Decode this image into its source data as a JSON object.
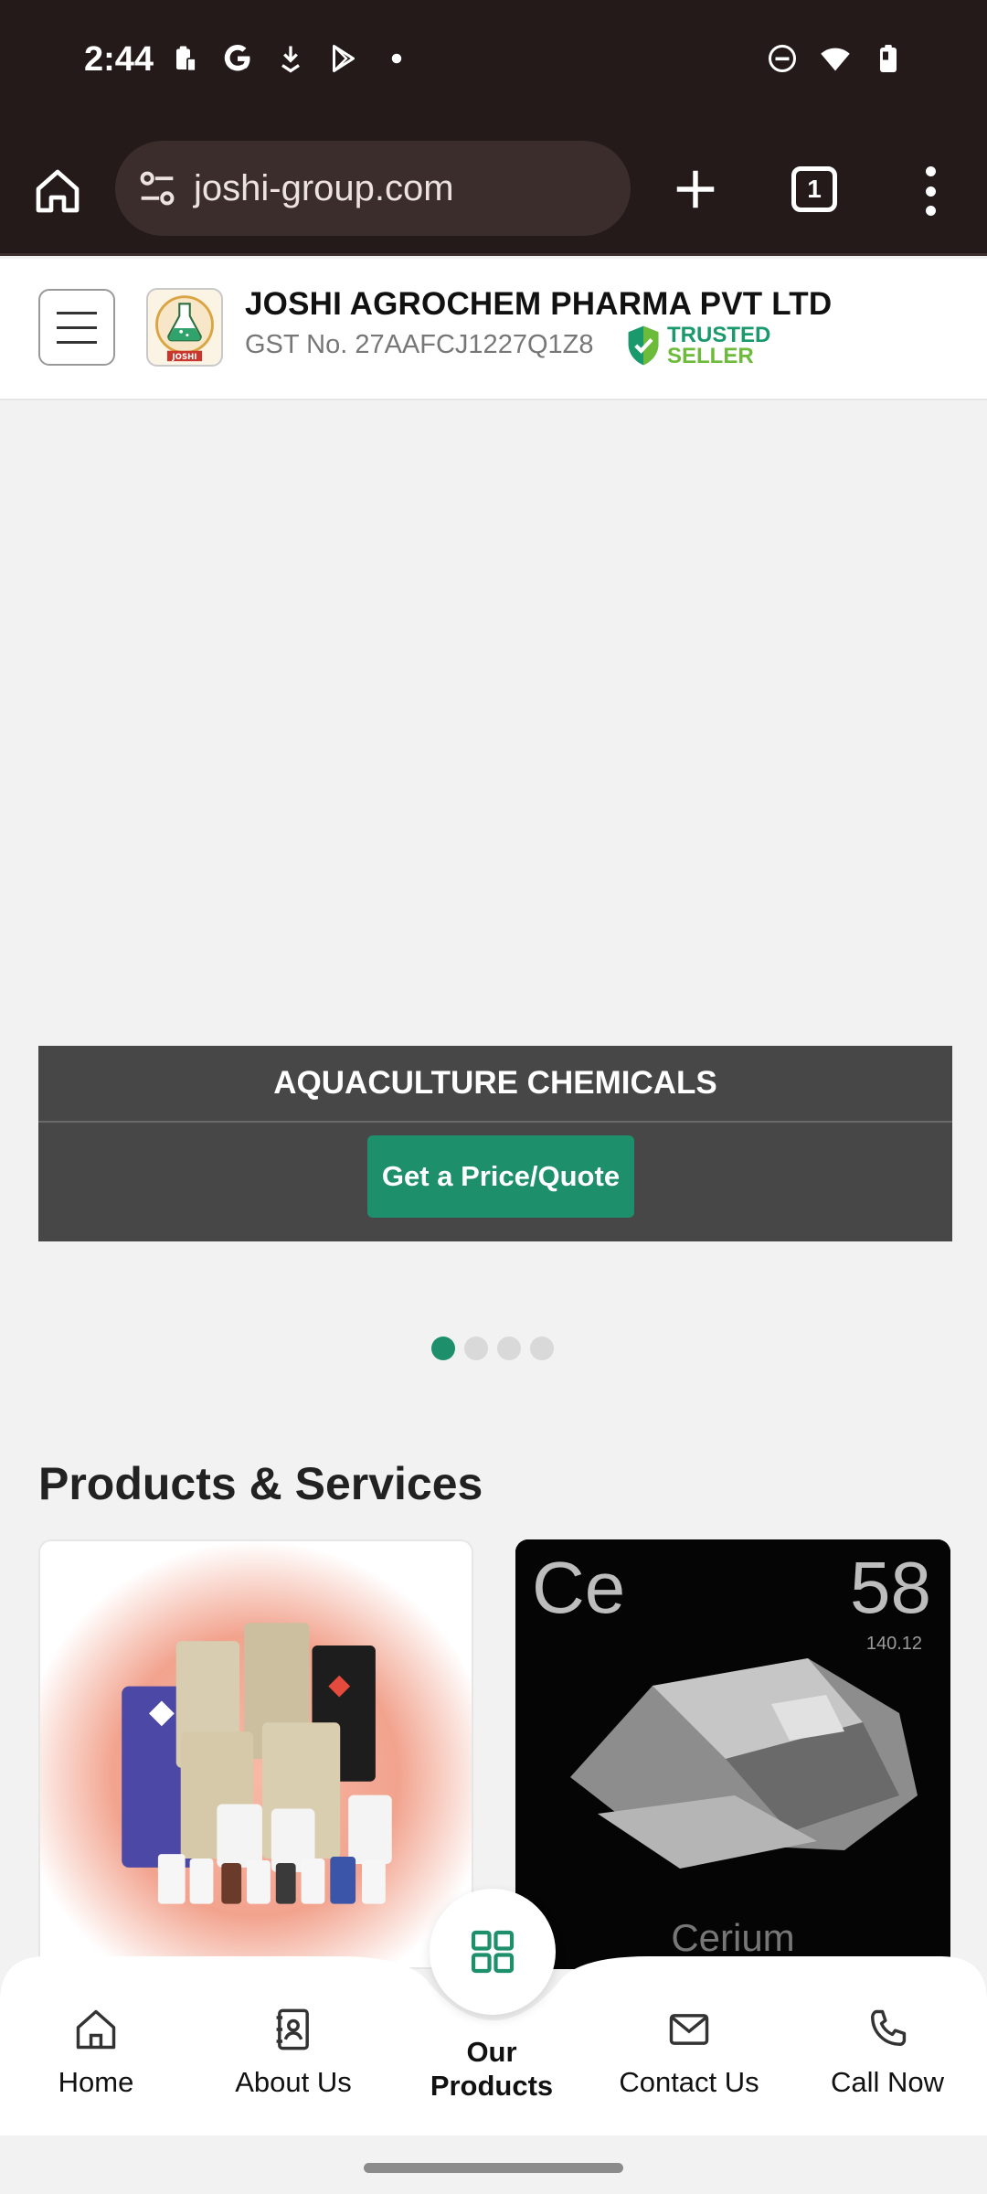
{
  "status_bar": {
    "time": "2:44",
    "left_icons": [
      "clipboard-icon",
      "google-icon",
      "download-icon",
      "play-store-icon",
      "dot-icon"
    ],
    "right_icons": [
      "do-not-disturb-icon",
      "wifi-icon",
      "battery-icon"
    ]
  },
  "browser": {
    "url": "joshi-group.com",
    "tab_count": "1"
  },
  "header": {
    "company_name": "JOSHI AGROCHEM PHARMA PVT LTD",
    "gst": "GST No. 27AAFCJ1227Q1Z8",
    "trusted_line1": "TRUSTED",
    "trusted_line2": "SELLER",
    "logo_text": "JOSHI"
  },
  "banner": {
    "title": "AQUACULTURE CHEMICALS",
    "button_label": "Get a Price/Quote",
    "slide_count": 4,
    "active_slide": 1
  },
  "products": {
    "section_title": "Products & Services",
    "card2_symbol": "Ce",
    "card2_number": "58",
    "card2_mass": "140.12",
    "card2_name": "Cerium"
  },
  "bottom_nav": {
    "home": "Home",
    "about": "About Us",
    "products_line1": "Our",
    "products_line2": "Products",
    "contact": "Contact Us",
    "call": "Call Now"
  },
  "colors": {
    "accent": "#1e8f6b",
    "browser_bg": "#231a19",
    "banner_bg": "#474747"
  }
}
